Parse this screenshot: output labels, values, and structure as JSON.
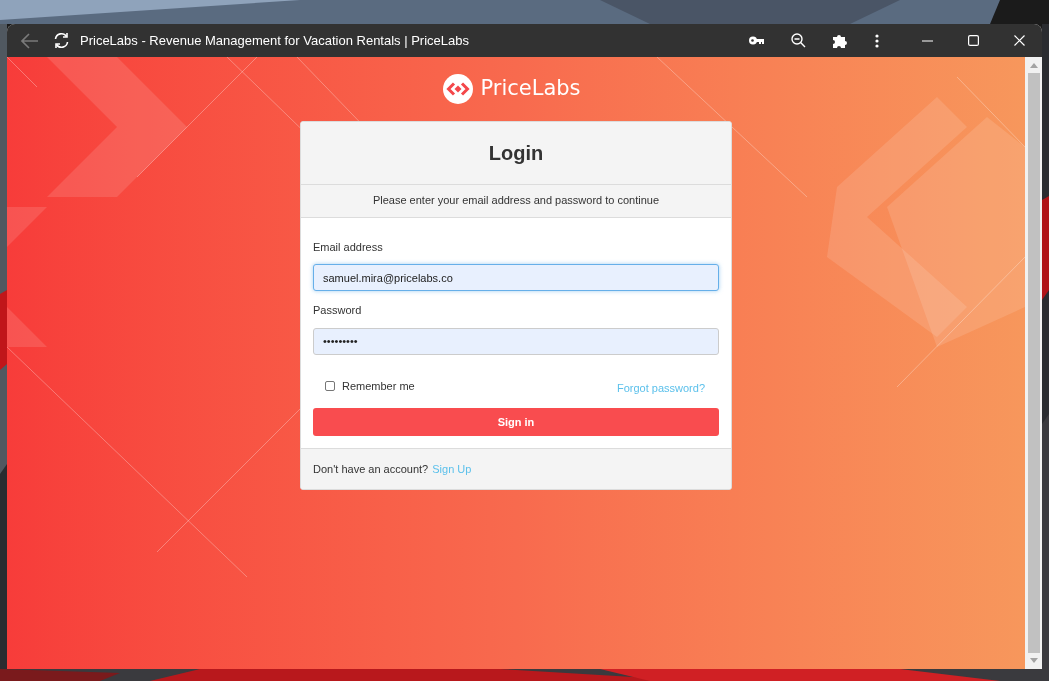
{
  "window": {
    "title": "PriceLabs - Revenue Management for Vacation Rentals | PriceLabs",
    "back_disabled": true
  },
  "logo": {
    "text": "PriceLabs"
  },
  "login": {
    "title": "Login",
    "subtitle": "Please enter your email address and password to continue",
    "fields": [
      {
        "label": "Email address",
        "value": "samuel.mira@pricelabs.co",
        "focused": true
      },
      {
        "label": "Password",
        "value": "•••••••••",
        "focused": false
      }
    ],
    "remember": {
      "label": "Remember me",
      "checked": false
    },
    "forgot_link": "Forgot password?",
    "submit": "Sign in",
    "footer": {
      "text": "Don't have an account?",
      "link": "Sign Up"
    }
  }
}
